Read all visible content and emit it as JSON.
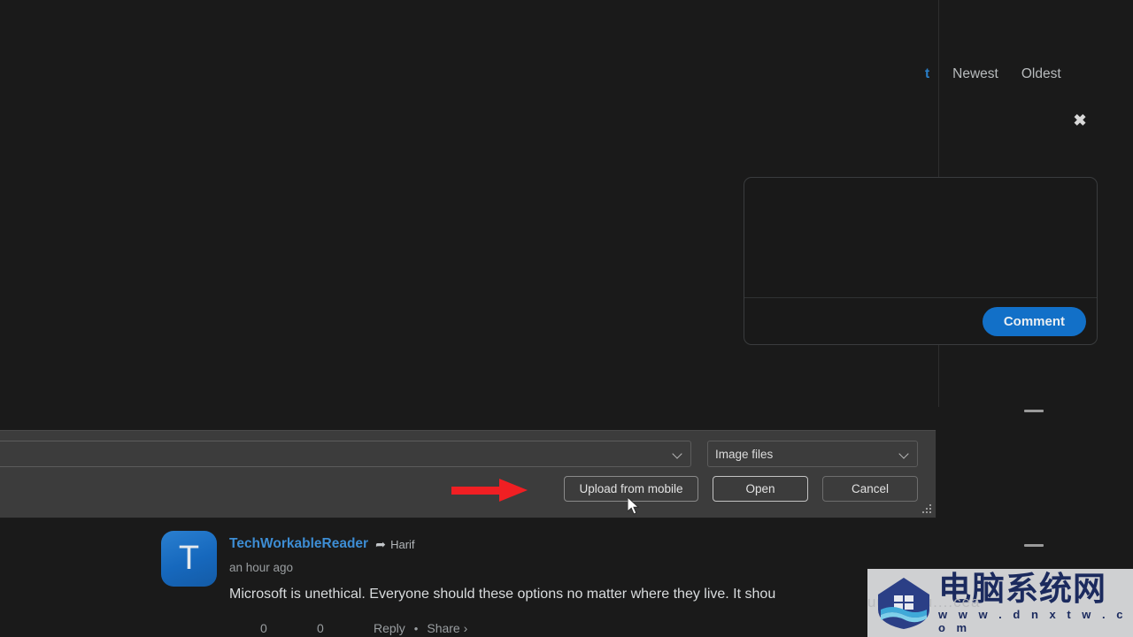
{
  "comment_section": {
    "sort_tabs": [
      {
        "label": "t",
        "active": true
      },
      {
        "label": "Newest",
        "active": false
      },
      {
        "label": "Oldest",
        "active": false
      }
    ],
    "close_icon": "✖",
    "composer": {
      "button_label": "Comment",
      "button_color": "#1270c8",
      "textarea_value": "",
      "textarea_placeholder": ""
    },
    "collapse_icons": [
      "minus-icon",
      "minus-icon"
    ]
  },
  "comment": {
    "avatar_initial": "T",
    "avatar_color": "#1668bd",
    "author": "TechWorkableReader",
    "author_color": "#3d8dd4",
    "reply_arrow": "➦",
    "reply_to": "Harif",
    "timestamp": "an hour ago",
    "body": "Microsoft is unethical. Everyone should these options no matter where they live. It shou",
    "upvotes": "0",
    "downvotes": "0",
    "reply_label": "Reply",
    "separator": "•",
    "share_label": "Share ›"
  },
  "file_dialog": {
    "filename_value": "",
    "filename_placeholder": "",
    "filetype_value": "Image files",
    "buttons": {
      "upload": "Upload from mobile",
      "open": "Open",
      "cancel": "Cancel"
    },
    "chevron_icon": "chevron-down-icon",
    "grip_icon": "resize-grip-icon"
  },
  "annotation": {
    "arrow_color": "#f01f23",
    "arrow_direction": "right",
    "points_to": "Upload from mobile"
  },
  "watermark": {
    "chinese_text": "电脑系统网",
    "url": "w w w . d n x t w . c o m",
    "ghost_text": "uuue.a.u....cea",
    "brand_color": "#1b2a5e"
  }
}
